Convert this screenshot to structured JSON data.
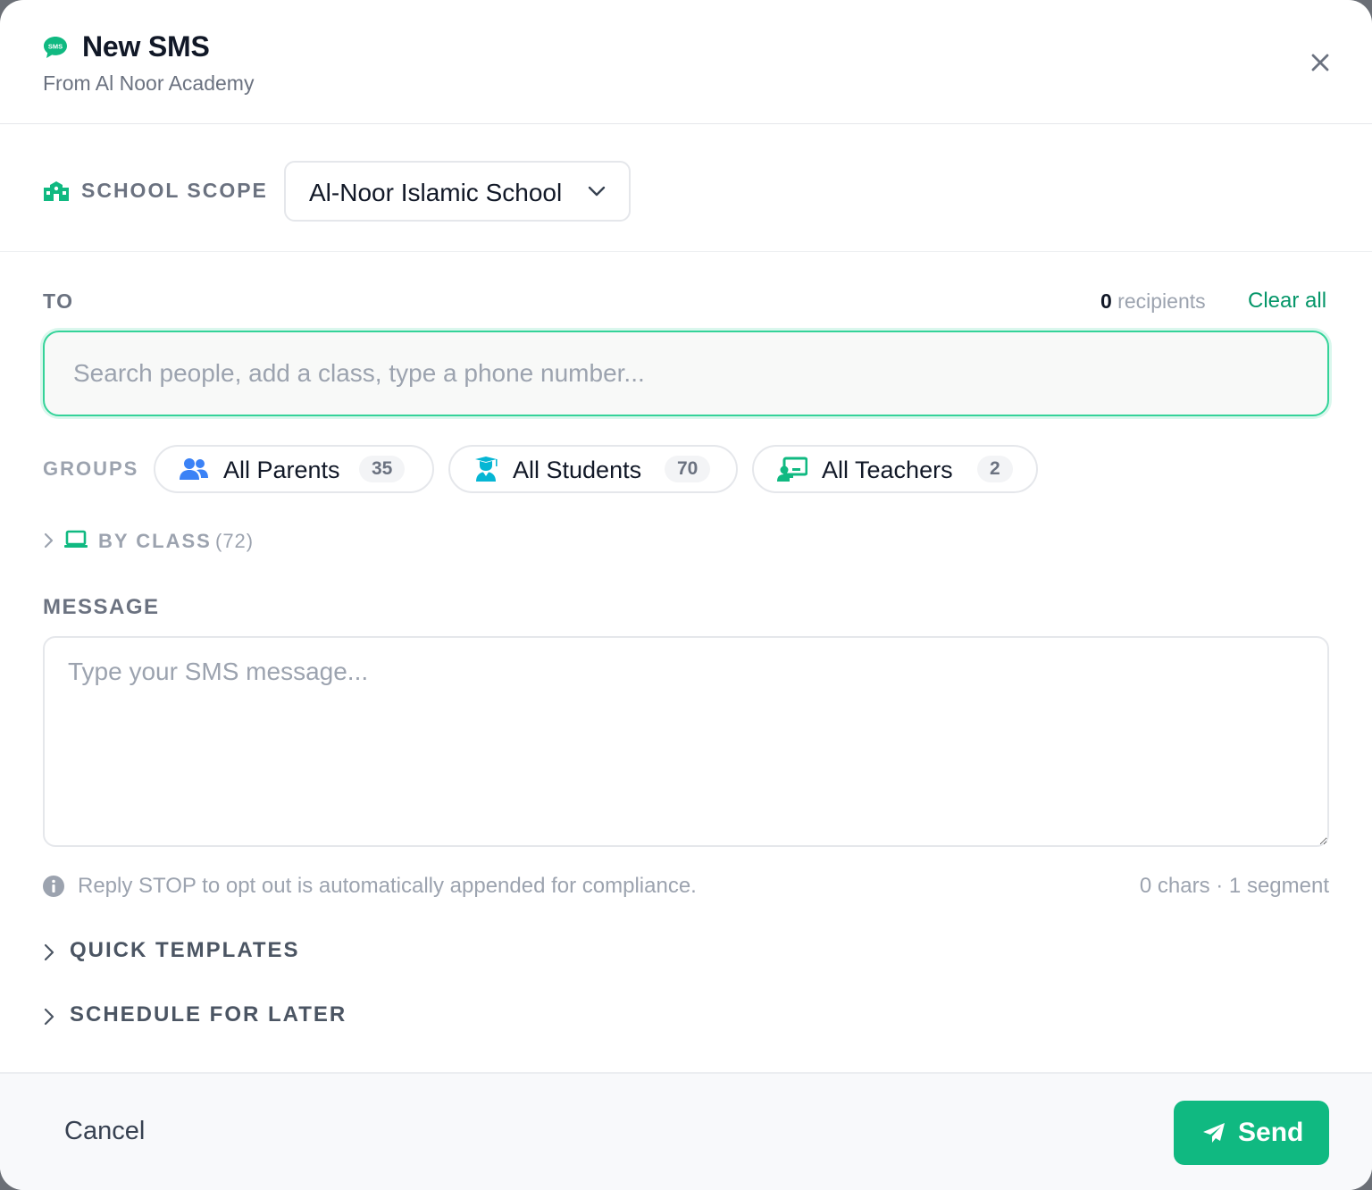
{
  "header": {
    "title": "New SMS",
    "subtitle": "From Al Noor Academy",
    "sms_icon_text": "SMS",
    "brand_color": "#10b981"
  },
  "scope": {
    "label": "SCHOOL SCOPE",
    "selected_school": "Al-Noor Islamic School"
  },
  "to": {
    "label": "TO",
    "recipient_count": "0",
    "recipient_suffix": " recipients",
    "clear_all_label": "Clear all",
    "search_placeholder": "Search people, add a class, type a phone number..."
  },
  "groups": {
    "label": "GROUPS",
    "items": [
      {
        "label": "All Parents",
        "count": "35",
        "icon": "users-icon",
        "color": "#3b82f6"
      },
      {
        "label": "All Students",
        "count": "70",
        "icon": "graduate-icon",
        "color": "#06b6d4"
      },
      {
        "label": "All Teachers",
        "count": "2",
        "icon": "teacher-icon",
        "color": "#10b981"
      }
    ]
  },
  "by_class": {
    "label": "BY CLASS",
    "count": "(72)"
  },
  "message": {
    "label": "MESSAGE",
    "placeholder": "Type your SMS message...",
    "notice": "Reply STOP to opt out is automatically appended for compliance.",
    "char_info": "0 chars · 1 segment"
  },
  "sections": {
    "quick_templates": "QUICK TEMPLATES",
    "schedule_later": "SCHEDULE FOR LATER"
  },
  "footer": {
    "cancel_label": "Cancel",
    "send_label": "Send"
  }
}
